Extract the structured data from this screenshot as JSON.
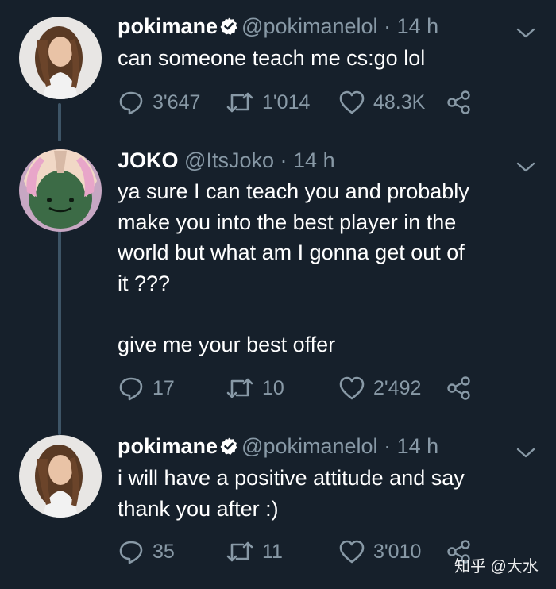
{
  "tweets": [
    {
      "name": "pokimane",
      "verified": true,
      "handle": "@pokimanelol",
      "dot": "·",
      "time": "14 h",
      "lines": [
        "can someone teach me cs:go lol"
      ],
      "replies": "3'647",
      "retweets": "1'014",
      "likes": "48.3K"
    },
    {
      "name": "JOKO",
      "verified": false,
      "handle": "@ItsJoko",
      "dot": "·",
      "time": "14 h",
      "lines": [
        "ya sure I can teach you and probably",
        "make you into the best player in the",
        "world but what am I gonna get out of",
        "it ???",
        "",
        "give me your best offer"
      ],
      "replies": "17",
      "retweets": "10",
      "likes": "2'492"
    },
    {
      "name": "pokimane",
      "verified": true,
      "handle": "@pokimanelol",
      "dot": "·",
      "time": "14 h",
      "lines": [
        "i will have a positive attitude and say",
        "thank you after :)"
      ],
      "replies": "35",
      "retweets": "11",
      "likes": "3'010"
    }
  ],
  "icons": {
    "reply": "reply-icon",
    "retweet": "retweet-icon",
    "like": "heart-icon",
    "share": "share-icon",
    "caret": "chevron-down-icon",
    "verified": "verified-badge-icon"
  },
  "colors": {
    "background": "#16202b",
    "secondary_text": "#8899a6",
    "verified": "#ffffff",
    "thread_line": "#3d5466"
  },
  "watermark": "知乎 @大水"
}
